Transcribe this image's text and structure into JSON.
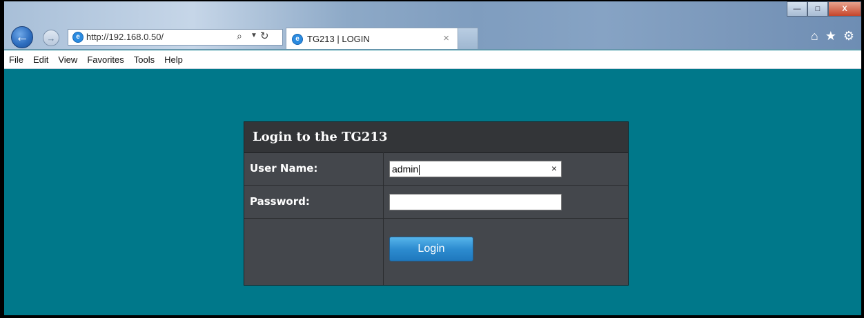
{
  "browser": {
    "address": "http://192.168.0.50/",
    "tab_title": "TG213 | LOGIN",
    "tab_close": "×",
    "window_buttons": {
      "minimize": "—",
      "maximize": "□",
      "close": "X"
    },
    "menu": [
      "File",
      "Edit",
      "View",
      "Favorites",
      "Tools",
      "Help"
    ]
  },
  "login": {
    "title": "Login to the TG213",
    "username_label": "User Name:",
    "username_value": "admin",
    "password_label": "Password:",
    "password_value": "",
    "clear_symbol": "×",
    "button_label": "Login"
  },
  "icons": {
    "back": "back-arrow-icon",
    "forward": "forward-arrow-icon",
    "site": "ie-logo-icon",
    "search": "search-icon",
    "refresh": "refresh-icon",
    "home": "home-icon",
    "favorites": "star-icon",
    "settings": "gear-icon"
  },
  "colors": {
    "page_background": "#00788a",
    "panel_background": "#44474c",
    "button_blue": "#2d8cd0"
  }
}
